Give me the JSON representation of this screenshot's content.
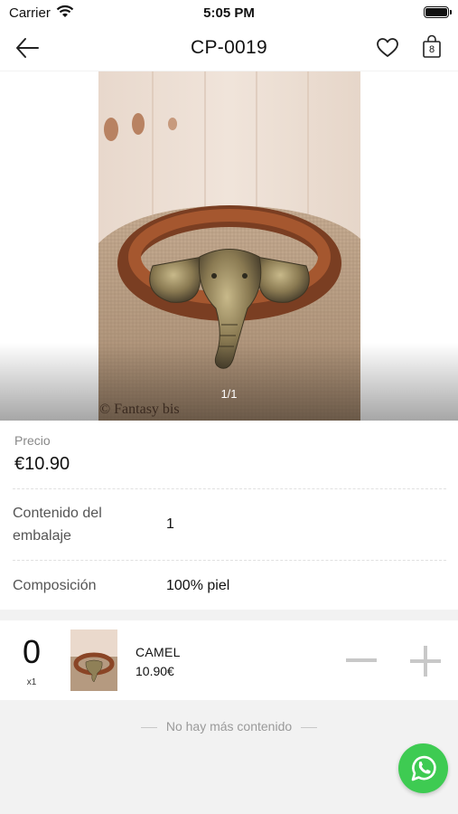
{
  "status_bar": {
    "carrier": "Carrier",
    "time": "5:05 PM"
  },
  "nav": {
    "title": "CP-0019",
    "cart_count": "8",
    "icons": [
      "back-arrow-icon",
      "heart-icon",
      "shopping-bag-icon"
    ]
  },
  "gallery": {
    "counter": "1/1",
    "watermark": "© Fantasy bis"
  },
  "product": {
    "price_label": "Precio",
    "price": "€10.90",
    "attributes": [
      {
        "label": "Contenido del embalaje",
        "value": "1"
      },
      {
        "label": "Composición",
        "value": "100% piel"
      }
    ]
  },
  "variant": {
    "quantity": "0",
    "unit": "x1",
    "name": "CAMEL",
    "price": "10.90€"
  },
  "footer": {
    "end_text": "No hay más contenido"
  },
  "colors": {
    "whatsapp": "#3ecb52",
    "stepper": "#c8c8c8",
    "muted_text": "#888888"
  }
}
